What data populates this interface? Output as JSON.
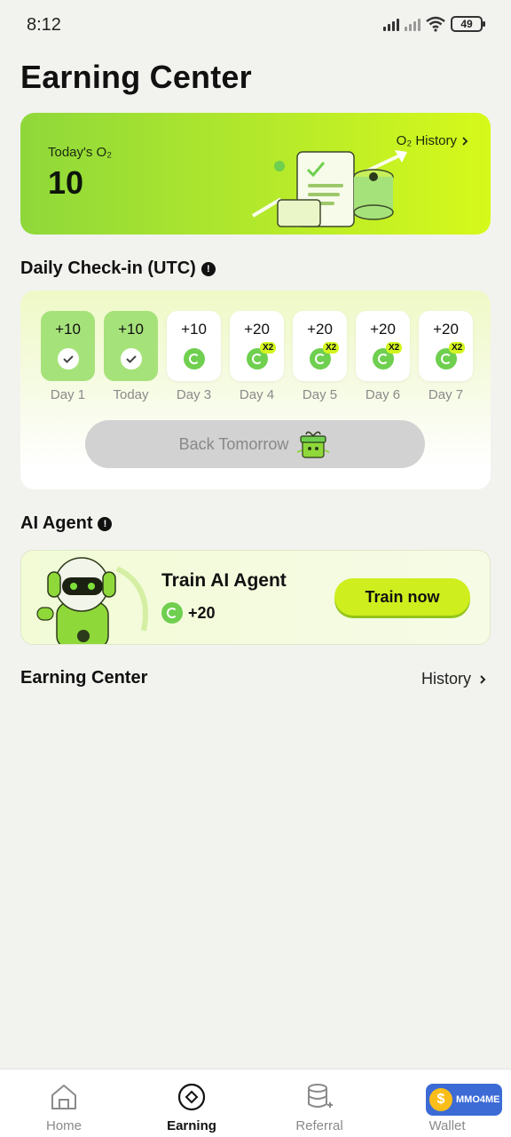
{
  "status_bar": {
    "time": "8:12",
    "battery": "49"
  },
  "page_title": "Earning Center",
  "hero": {
    "label": "Today's O₂",
    "value": "10",
    "history_link": "O₂ History"
  },
  "checkin": {
    "title": "Daily Check-in (UTC)",
    "days": [
      {
        "amount": "+10",
        "label": "Day 1",
        "state": "done"
      },
      {
        "amount": "+10",
        "label": "Today",
        "state": "done"
      },
      {
        "amount": "+10",
        "label": "Day 3",
        "state": "pending"
      },
      {
        "amount": "+20",
        "label": "Day 4",
        "state": "pending",
        "badge": "X2"
      },
      {
        "amount": "+20",
        "label": "Day 5",
        "state": "pending",
        "badge": "X2"
      },
      {
        "amount": "+20",
        "label": "Day 6",
        "state": "pending",
        "badge": "X2"
      },
      {
        "amount": "+20",
        "label": "Day 7",
        "state": "pending",
        "badge": "X2"
      }
    ],
    "button": "Back Tomorrow"
  },
  "agent": {
    "section_title": "AI Agent",
    "title": "Train AI Agent",
    "reward": "+20",
    "button": "Train now"
  },
  "earning_center": {
    "title": "Earning Center",
    "history": "History"
  },
  "nav": [
    {
      "label": "Home",
      "icon": "home-icon"
    },
    {
      "label": "Earning",
      "icon": "earning-icon",
      "active": true
    },
    {
      "label": "Referral",
      "icon": "referral-icon"
    },
    {
      "label": "Wallet",
      "icon": "wallet-icon"
    }
  ],
  "watermark": "MMO4ME",
  "colors": {
    "accent": "#cfee1e",
    "accent_green": "#8fd83a",
    "done_day": "#a6e27a",
    "coin": "#6fcf4f"
  }
}
